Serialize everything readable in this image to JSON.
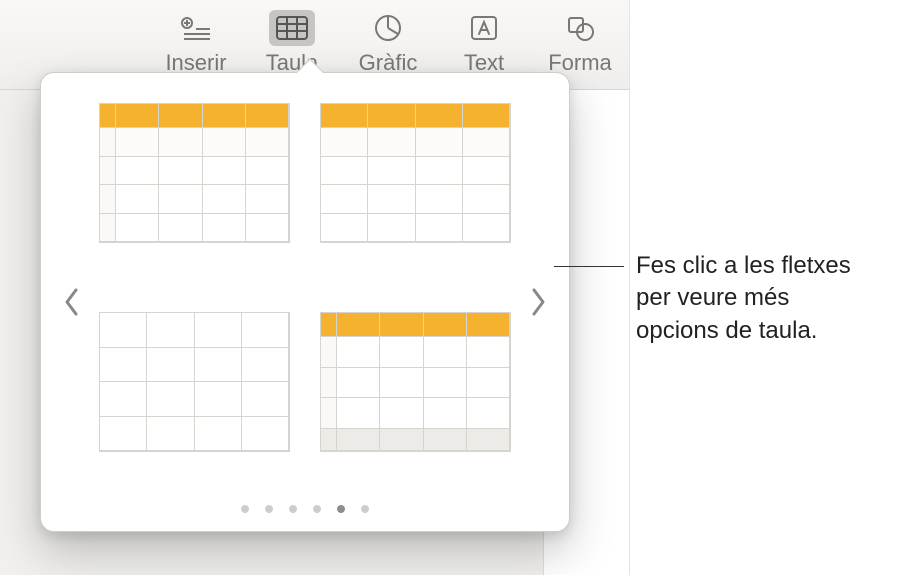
{
  "toolbar": {
    "items": [
      {
        "name": "inserir-button",
        "label": "Inserir",
        "icon": "insert-icon",
        "active": false
      },
      {
        "name": "taula-button",
        "label": "Taula",
        "icon": "table-icon",
        "active": true
      },
      {
        "name": "grafic-button",
        "label": "Gràfic",
        "icon": "chart-icon",
        "active": false
      },
      {
        "name": "text-button",
        "label": "Text",
        "icon": "text-icon",
        "active": false
      },
      {
        "name": "forma-button",
        "label": "Forma",
        "icon": "shape-icon",
        "active": false
      }
    ]
  },
  "popover": {
    "accent_color": "#f4b22e",
    "page_count": 6,
    "current_page_index": 4,
    "styles": [
      {
        "name": "table-style-header-stub",
        "header_row": true,
        "stub_col": true,
        "footer_row": false
      },
      {
        "name": "table-style-header-only",
        "header_row": true,
        "stub_col": false,
        "footer_row": false
      },
      {
        "name": "table-style-plain",
        "header_row": false,
        "stub_col": false,
        "footer_row": false
      },
      {
        "name": "table-style-header-footer",
        "header_row": true,
        "stub_col": true,
        "footer_row": true
      }
    ]
  },
  "callout": {
    "line1": "Fes clic a les fletxes",
    "line2": "per veure més",
    "line3": "opcions de taula."
  }
}
